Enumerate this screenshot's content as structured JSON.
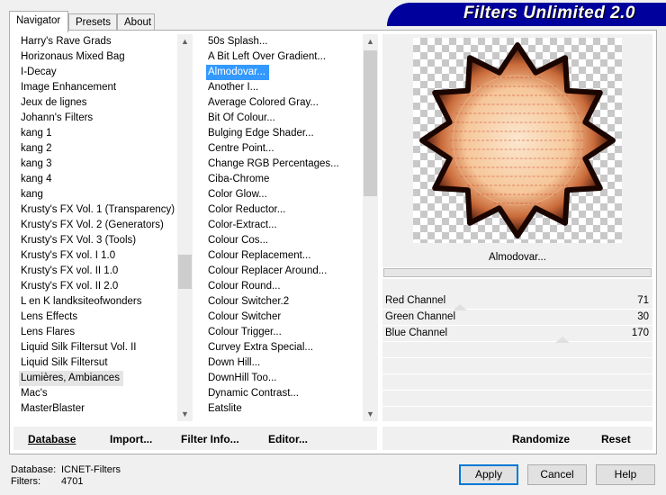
{
  "tabs": [
    "Navigator",
    "Presets",
    "About"
  ],
  "banner_title": "Filters Unlimited 2.0",
  "categories": [
    "Harry's Rave Grads",
    "Horizonaus Mixed Bag",
    "I-Decay",
    "Image Enhancement",
    "Jeux de lignes",
    "Johann's Filters",
    "kang 1",
    "kang 2",
    "kang 3",
    "kang 4",
    "kang",
    "Krusty's FX Vol. 1 (Transparency)",
    "Krusty's FX Vol. 2 (Generators)",
    "Krusty's FX Vol. 3 (Tools)",
    "Krusty's FX vol. I 1.0",
    "Krusty's FX vol. II 1.0",
    "Krusty's FX vol. II 2.0",
    "L en K landksiteofwonders",
    "Lens Effects",
    "Lens Flares",
    "Liquid Silk Filtersut Vol. II",
    "Liquid Silk Filtersut",
    "Lumières, Ambiances",
    "Mac's",
    "MasterBlaster"
  ],
  "selected_category": "Lumières, Ambiances",
  "filters": [
    "50s Splash...",
    "A Bit Left Over Gradient...",
    "Almodovar...",
    "Another I...",
    "Average Colored Gray...",
    "Bit Of Colour...",
    "Bulging Edge Shader...",
    "Centre Point...",
    "Change RGB Percentages...",
    "Ciba-Chrome",
    "Color Glow...",
    "Color Reductor...",
    "Color-Extract...",
    "Colour Cos...",
    "Colour Replacement...",
    "Colour Replacer Around...",
    "Colour Round...",
    "Colour Switcher.2",
    "Colour Switcher",
    "Colour Trigger...",
    "Curvey Extra Special...",
    "Down Hill...",
    "DownHill Too...",
    "Dynamic Contrast...",
    "Eatslite"
  ],
  "selected_filter": "Almodovar...",
  "buttons": {
    "database": "Database",
    "import": "Import...",
    "filter_info": "Filter Info...",
    "editor": "Editor...",
    "randomize": "Randomize",
    "reset": "Reset",
    "apply": "Apply",
    "cancel": "Cancel",
    "help": "Help"
  },
  "preview": {
    "filter_name": "Almodovar...",
    "progress": 0
  },
  "sliders": [
    {
      "label": "Red Channel",
      "value": 71,
      "max": 255
    },
    {
      "label": "Green Channel",
      "value": 30,
      "max": 255
    },
    {
      "label": "Blue Channel",
      "value": 170,
      "max": 255
    }
  ],
  "status": {
    "database_label": "Database:",
    "database_value": "ICNET-Filters",
    "filters_label": "Filters:",
    "filters_value": "4701"
  },
  "colors": {
    "banner": "#00009c",
    "selection": "#3399ff",
    "default_button_border": "#0078d7"
  },
  "icons": [
    "scroll-up-icon",
    "scroll-down-icon"
  ]
}
